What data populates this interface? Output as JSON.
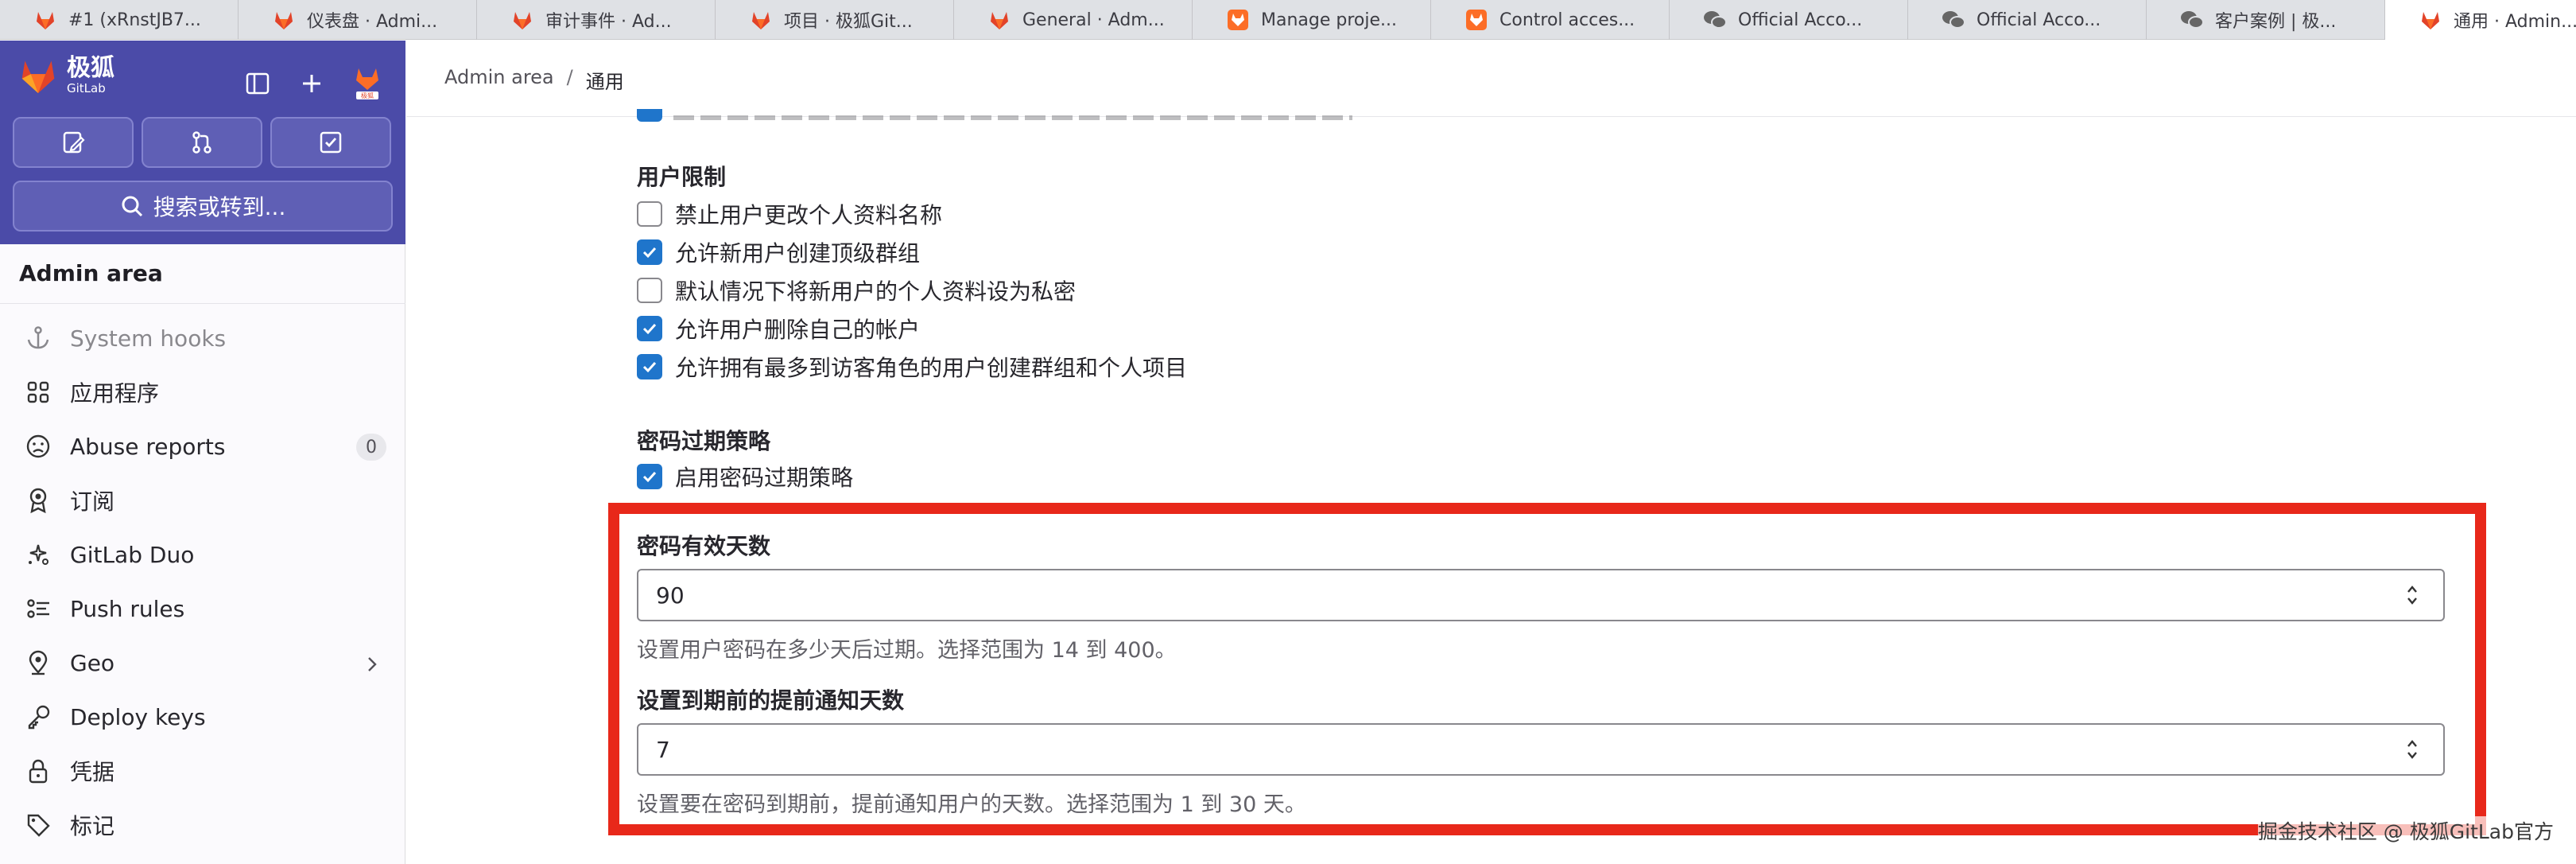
{
  "browser_tabs": [
    {
      "label": "#1 (xRnstJB7...",
      "icon": "gitlab-icon"
    },
    {
      "label": "仪表盘 · Admi...",
      "icon": "gitlab-icon"
    },
    {
      "label": "审计事件 · Ad...",
      "icon": "gitlab-icon"
    },
    {
      "label": "项目 · 极狐Git...",
      "icon": "gitlab-icon"
    },
    {
      "label": "General · Adm...",
      "icon": "gitlab-icon"
    },
    {
      "label": "Manage proje...",
      "icon": "gitlab-square-icon"
    },
    {
      "label": "Control acces...",
      "icon": "gitlab-square-icon"
    },
    {
      "label": "Official Acco...",
      "icon": "wechat-icon"
    },
    {
      "label": "Official Acco...",
      "icon": "wechat-icon"
    },
    {
      "label": "客户案例 | 极...",
      "icon": "wechat-icon"
    },
    {
      "label": "通用 · Admin...",
      "icon": "gitlab-icon",
      "active": true
    }
  ],
  "sidebar": {
    "brand": {
      "name": "极狐",
      "sub": "GitLab"
    },
    "search_label": "搜索或转到...",
    "section_title": "Admin area",
    "items": [
      {
        "label": "System hooks",
        "icon": "anchor-icon"
      },
      {
        "label": "应用程序",
        "icon": "apps-grid-icon"
      },
      {
        "label": "Abuse reports",
        "icon": "abuse-face-icon",
        "badge": "0"
      },
      {
        "label": "订阅",
        "icon": "subscription-icon"
      },
      {
        "label": "GitLab Duo",
        "icon": "duo-icon"
      },
      {
        "label": "Push rules",
        "icon": "push-rules-icon"
      },
      {
        "label": "Geo",
        "icon": "location-pin-icon"
      },
      {
        "label": "Deploy keys",
        "icon": "key-icon"
      },
      {
        "label": "凭据",
        "icon": "lock-icon"
      },
      {
        "label": "标记",
        "icon": "label-tag-icon"
      }
    ]
  },
  "breadcrumb": {
    "root": "Admin area",
    "separator": "/",
    "current": "通用"
  },
  "user_restrictions": {
    "title": "用户限制",
    "options": [
      {
        "label": "禁止用户更改个人资料名称",
        "checked": false
      },
      {
        "label": "允许新用户创建顶级群组",
        "checked": true
      },
      {
        "label": "默认情况下将新用户的个人资料设为私密",
        "checked": false
      },
      {
        "label": "允许用户删除自己的帐户",
        "checked": true
      },
      {
        "label": "允许拥有最多到访客角色的用户创建群组和个人项目",
        "checked": true
      }
    ]
  },
  "password_policy": {
    "title": "密码过期策略",
    "enable_label": "启用密码过期策略",
    "enable_checked": true,
    "days_label": "密码有效天数",
    "days_value": "90",
    "days_help": "设置用户密码在多少天后过期。选择范围为 14 到 400。",
    "notice_label": "设置到期前的提前通知天数",
    "notice_value": "7",
    "notice_help": "设置要在密码到期前，提前通知用户的天数。选择范围为 1 到 30 天。"
  },
  "watermark": "掘金技术社区 @ 极狐GitLab官方",
  "colors": {
    "highlight": "#e8281a",
    "sidebar_header": "#4b4ba8",
    "checkbox_on": "#1f75cb"
  }
}
